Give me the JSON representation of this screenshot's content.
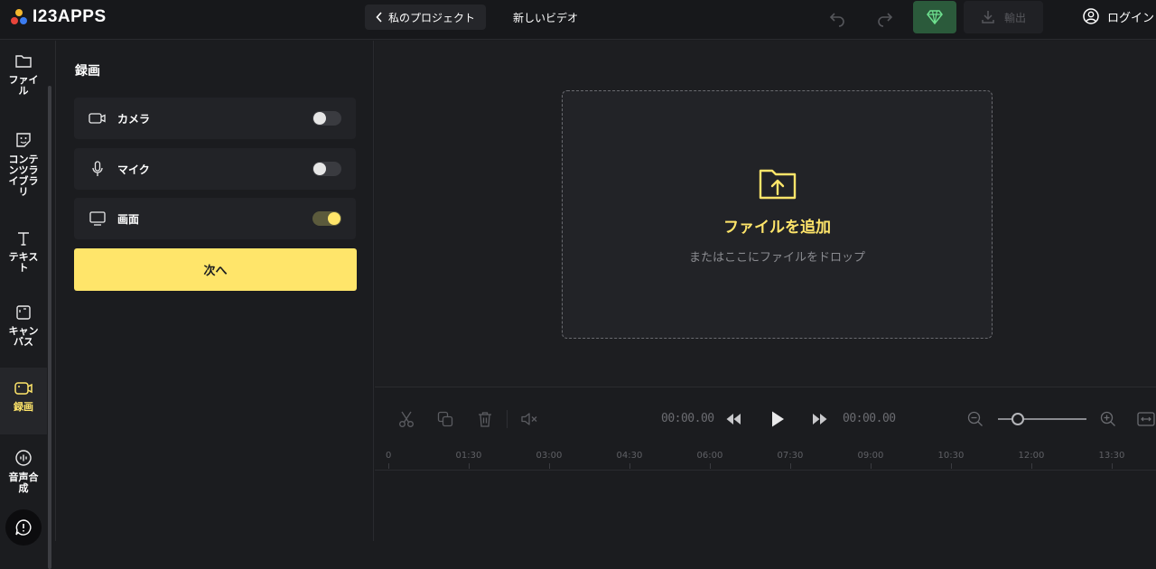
{
  "header": {
    "logo_text": "I23APPS",
    "back_label": "私のプロジェクト",
    "project_name": "新しいビデオ",
    "export_label": "輸出",
    "login_label": "ログイン",
    "icons": [
      "undo-icon",
      "redo-icon",
      "diamond-icon",
      "download-icon",
      "user-circle-icon"
    ]
  },
  "sidebar": {
    "items": [
      {
        "label": "ファイル",
        "icon": "folder-icon"
      },
      {
        "label": "コンテンツライブラリ",
        "icon": "sticker-icon"
      },
      {
        "label": "テキスト",
        "icon": "text-icon"
      },
      {
        "label": "キャンバス",
        "icon": "canvas-icon"
      },
      {
        "label": "録画",
        "icon": "record-icon",
        "active": true
      },
      {
        "label": "音声合成",
        "icon": "voice-icon"
      }
    ]
  },
  "panel": {
    "title": "録画",
    "rows": [
      {
        "label": "カメラ",
        "icon": "camera-icon",
        "enabled": false
      },
      {
        "label": "マイク",
        "icon": "microphone-icon",
        "enabled": false
      },
      {
        "label": "画面",
        "icon": "monitor-icon",
        "enabled": true
      }
    ],
    "next_label": "次へ"
  },
  "drop_zone": {
    "title": "ファイルを追加",
    "subtitle": "またはここにファイルをドロップ"
  },
  "timeline": {
    "current_time": "00:00.00",
    "total_time": "00:00.00",
    "ruler_ticks": [
      "0",
      "01:30",
      "03:00",
      "04:30",
      "06:00",
      "07:30",
      "09:00",
      "10:30",
      "12:00",
      "13:30"
    ],
    "zoom_level": 0.18
  },
  "colors": {
    "accent": "#ffe56a",
    "premium": "#2b5a3b",
    "background": "#1b1c1f"
  }
}
